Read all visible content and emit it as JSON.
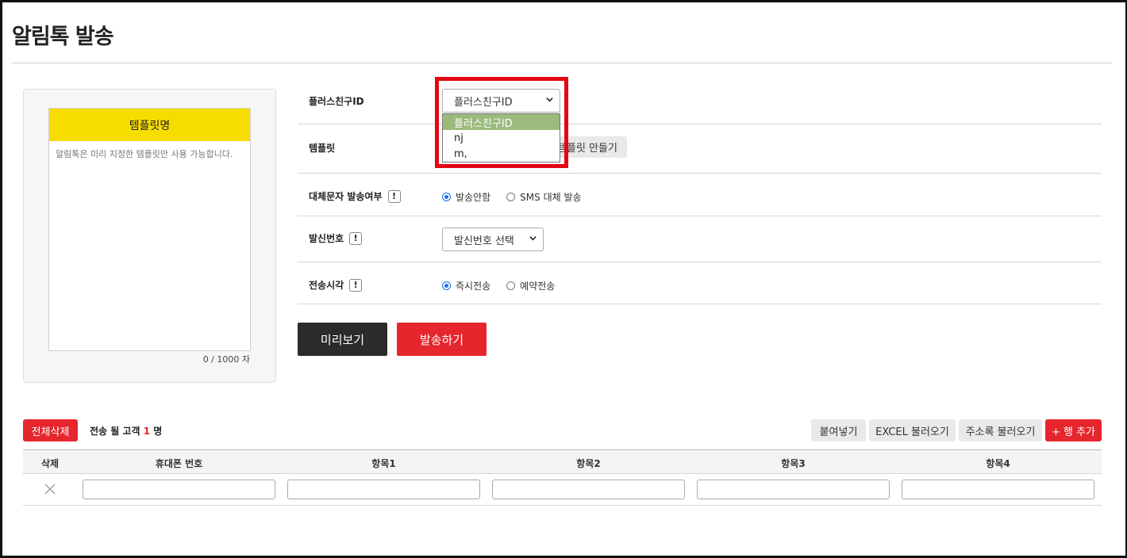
{
  "page": {
    "title": "알림톡 발송"
  },
  "preview": {
    "template_name": "템플릿명",
    "body_text": "알림톡은 미리 지정한 템플릿만 사용 가능합니다.",
    "counter": "0 / 1000 자"
  },
  "form": {
    "plus_friend": {
      "label": "플러스친구ID",
      "selected": "플러스친구ID",
      "options": [
        "플러스친구ID",
        "nj",
        "m,"
      ]
    },
    "template": {
      "label": "템플릿",
      "create_button": "템플릿 만들기"
    },
    "fallback": {
      "label": "대체문자 발송여부",
      "options": [
        "발송안함",
        "SMS 대체 발송"
      ],
      "selected": "발송안함"
    },
    "sender": {
      "label": "발신번호",
      "selected": "발신번호 선택"
    },
    "send_time": {
      "label": "전송시각",
      "options": [
        "즉시전송",
        "예약전송"
      ],
      "selected": "즉시전송"
    },
    "info_glyph": "!"
  },
  "actions": {
    "preview": "미리보기",
    "send": "발송하기"
  },
  "recipients": {
    "delete_all": "전체삭제",
    "count_prefix": "전송 될 고객",
    "count": "1",
    "count_suffix": "명",
    "buttons": {
      "paste": "붙여넣기",
      "excel": "EXCEL 불러오기",
      "address_book": "주소록 불러오기",
      "add_row": "+ 행 추가"
    },
    "columns": [
      "삭제",
      "휴대폰 번호",
      "항목1",
      "항목2",
      "항목3",
      "항목4"
    ]
  },
  "colors": {
    "accent_red": "#e5262d",
    "kakao_yellow": "#f7dc00",
    "option_highlight": "#9bbb7d",
    "annotation_red": "#e30613"
  }
}
